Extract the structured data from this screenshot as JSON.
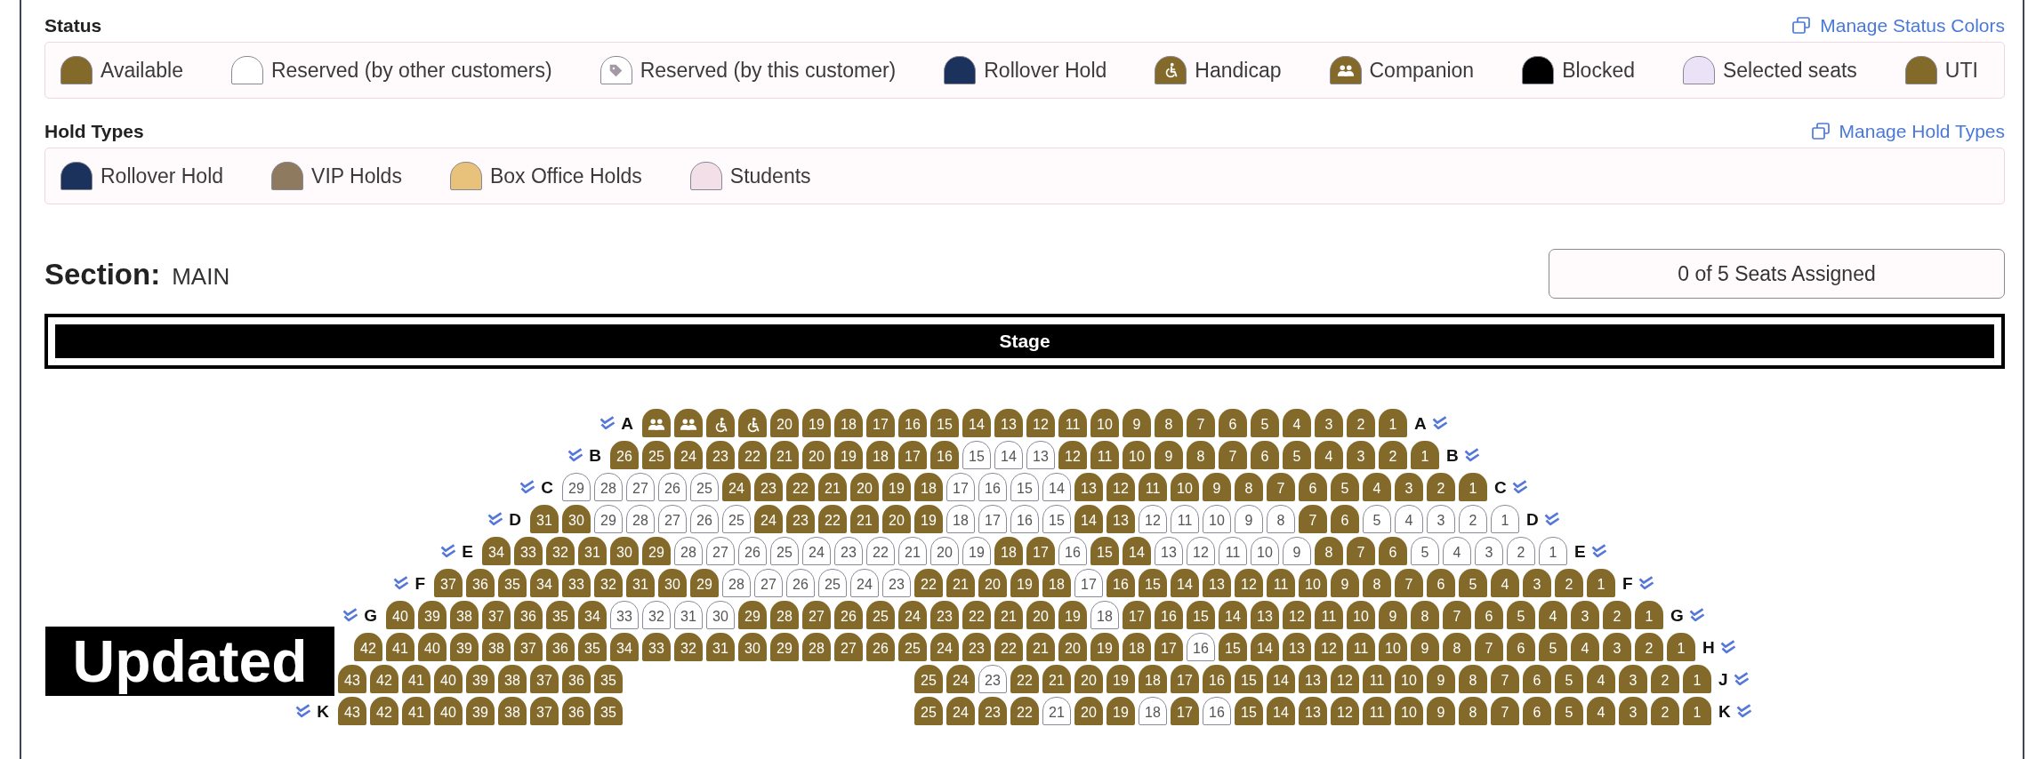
{
  "status": {
    "title": "Status",
    "link": "Manage Status Colors",
    "items": [
      {
        "label": "Available",
        "color": "#836a2b",
        "kind": "plain"
      },
      {
        "label": "Reserved (by other customers)",
        "color": "#ffffff",
        "kind": "plain"
      },
      {
        "label": "Reserved (by this customer)",
        "color": "#ffffff",
        "kind": "tag"
      },
      {
        "label": "Rollover Hold",
        "color": "#1b335c",
        "kind": "plain"
      },
      {
        "label": "Handicap",
        "color": "#836a2b",
        "kind": "wheelchair"
      },
      {
        "label": "Companion",
        "color": "#836a2b",
        "kind": "companion"
      },
      {
        "label": "Blocked",
        "color": "#000000",
        "kind": "plain"
      },
      {
        "label": "Selected seats",
        "color": "#ece2f8",
        "kind": "plain"
      },
      {
        "label": "UTI",
        "color": "#836a2b",
        "kind": "plain"
      }
    ]
  },
  "hold_types": {
    "title": "Hold Types",
    "link": "Manage Hold Types",
    "items": [
      {
        "label": "Rollover Hold",
        "color": "#1b335c"
      },
      {
        "label": "VIP Holds",
        "color": "#8e7a5f"
      },
      {
        "label": "Box Office Holds",
        "color": "#e8c27a"
      },
      {
        "label": "Students",
        "color": "#f3dfe8"
      }
    ]
  },
  "section": {
    "label": "Section:",
    "name": "MAIN",
    "assigned": "0 of 5 Seats Assigned"
  },
  "stage": {
    "label": "Stage"
  },
  "rows": [
    {
      "label_left": "A",
      "label_right": "A",
      "seats": [
        {
          "kind": "companion"
        },
        {
          "kind": "companion"
        },
        {
          "kind": "handicap"
        },
        {
          "kind": "handicap"
        },
        {
          "number": "20",
          "kind": "available"
        },
        {
          "number": "19",
          "kind": "available"
        },
        {
          "number": "18",
          "kind": "available"
        },
        {
          "number": "17",
          "kind": "available"
        },
        {
          "number": "16",
          "kind": "available"
        },
        {
          "number": "15",
          "kind": "available"
        },
        {
          "number": "14",
          "kind": "available"
        },
        {
          "number": "13",
          "kind": "available"
        },
        {
          "number": "12",
          "kind": "available"
        },
        {
          "number": "11",
          "kind": "available"
        },
        {
          "number": "10",
          "kind": "available"
        },
        {
          "number": "9",
          "kind": "available"
        },
        {
          "number": "8",
          "kind": "available"
        },
        {
          "number": "7",
          "kind": "available"
        },
        {
          "number": "6",
          "kind": "available"
        },
        {
          "number": "5",
          "kind": "available"
        },
        {
          "number": "4",
          "kind": "available"
        },
        {
          "number": "3",
          "kind": "available"
        },
        {
          "number": "2",
          "kind": "available"
        },
        {
          "number": "1",
          "kind": "available"
        }
      ]
    },
    {
      "label_left": "B",
      "label_right": "B",
      "seats": [
        {
          "number": "26",
          "kind": "available"
        },
        {
          "number": "25",
          "kind": "available"
        },
        {
          "number": "24",
          "kind": "available"
        },
        {
          "number": "23",
          "kind": "available"
        },
        {
          "number": "22",
          "kind": "available"
        },
        {
          "number": "21",
          "kind": "available"
        },
        {
          "number": "20",
          "kind": "available"
        },
        {
          "number": "19",
          "kind": "available"
        },
        {
          "number": "18",
          "kind": "available"
        },
        {
          "number": "17",
          "kind": "available"
        },
        {
          "number": "16",
          "kind": "available"
        },
        {
          "number": "15",
          "kind": "reserved"
        },
        {
          "number": "14",
          "kind": "reserved"
        },
        {
          "number": "13",
          "kind": "reserved"
        },
        {
          "number": "12",
          "kind": "available"
        },
        {
          "number": "11",
          "kind": "available"
        },
        {
          "number": "10",
          "kind": "available"
        },
        {
          "number": "9",
          "kind": "available"
        },
        {
          "number": "8",
          "kind": "available"
        },
        {
          "number": "7",
          "kind": "available"
        },
        {
          "number": "6",
          "kind": "available"
        },
        {
          "number": "5",
          "kind": "available"
        },
        {
          "number": "4",
          "kind": "available"
        },
        {
          "number": "3",
          "kind": "available"
        },
        {
          "number": "2",
          "kind": "available"
        },
        {
          "number": "1",
          "kind": "available"
        }
      ]
    },
    {
      "label_left": "C",
      "label_right": "C",
      "seats": [
        {
          "number": "29",
          "kind": "reserved"
        },
        {
          "number": "28",
          "kind": "reserved"
        },
        {
          "number": "27",
          "kind": "reserved"
        },
        {
          "number": "26",
          "kind": "reserved"
        },
        {
          "number": "25",
          "kind": "reserved"
        },
        {
          "number": "24",
          "kind": "available"
        },
        {
          "number": "23",
          "kind": "available"
        },
        {
          "number": "22",
          "kind": "available"
        },
        {
          "number": "21",
          "kind": "available"
        },
        {
          "number": "20",
          "kind": "available"
        },
        {
          "number": "19",
          "kind": "available"
        },
        {
          "number": "18",
          "kind": "available"
        },
        {
          "number": "17",
          "kind": "reserved"
        },
        {
          "number": "16",
          "kind": "reserved"
        },
        {
          "number": "15",
          "kind": "reserved"
        },
        {
          "number": "14",
          "kind": "reserved"
        },
        {
          "number": "13",
          "kind": "available"
        },
        {
          "number": "12",
          "kind": "available"
        },
        {
          "number": "11",
          "kind": "available"
        },
        {
          "number": "10",
          "kind": "available"
        },
        {
          "number": "9",
          "kind": "available"
        },
        {
          "number": "8",
          "kind": "available"
        },
        {
          "number": "7",
          "kind": "available"
        },
        {
          "number": "6",
          "kind": "available"
        },
        {
          "number": "5",
          "kind": "available"
        },
        {
          "number": "4",
          "kind": "available"
        },
        {
          "number": "3",
          "kind": "available"
        },
        {
          "number": "2",
          "kind": "available"
        },
        {
          "number": "1",
          "kind": "available"
        }
      ]
    },
    {
      "label_left": "D",
      "label_right": "D",
      "seats": [
        {
          "number": "31",
          "kind": "available"
        },
        {
          "number": "30",
          "kind": "available"
        },
        {
          "number": "29",
          "kind": "reserved"
        },
        {
          "number": "28",
          "kind": "reserved"
        },
        {
          "number": "27",
          "kind": "reserved"
        },
        {
          "number": "26",
          "kind": "reserved"
        },
        {
          "number": "25",
          "kind": "reserved"
        },
        {
          "number": "24",
          "kind": "available"
        },
        {
          "number": "23",
          "kind": "available"
        },
        {
          "number": "22",
          "kind": "available"
        },
        {
          "number": "21",
          "kind": "available"
        },
        {
          "number": "20",
          "kind": "available"
        },
        {
          "number": "19",
          "kind": "available"
        },
        {
          "number": "18",
          "kind": "reserved"
        },
        {
          "number": "17",
          "kind": "reserved"
        },
        {
          "number": "16",
          "kind": "reserved"
        },
        {
          "number": "15",
          "kind": "reserved"
        },
        {
          "number": "14",
          "kind": "available"
        },
        {
          "number": "13",
          "kind": "available"
        },
        {
          "number": "12",
          "kind": "reserved"
        },
        {
          "number": "11",
          "kind": "reserved"
        },
        {
          "number": "10",
          "kind": "reserved"
        },
        {
          "number": "9",
          "kind": "reserved"
        },
        {
          "number": "8",
          "kind": "reserved"
        },
        {
          "number": "7",
          "kind": "available"
        },
        {
          "number": "6",
          "kind": "available"
        },
        {
          "number": "5",
          "kind": "reserved"
        },
        {
          "number": "4",
          "kind": "reserved"
        },
        {
          "number": "3",
          "kind": "reserved"
        },
        {
          "number": "2",
          "kind": "reserved"
        },
        {
          "number": "1",
          "kind": "reserved"
        }
      ]
    },
    {
      "label_left": "E",
      "label_right": "E",
      "seats": [
        {
          "number": "34",
          "kind": "available"
        },
        {
          "number": "33",
          "kind": "available"
        },
        {
          "number": "32",
          "kind": "available"
        },
        {
          "number": "31",
          "kind": "available"
        },
        {
          "number": "30",
          "kind": "available"
        },
        {
          "number": "29",
          "kind": "available"
        },
        {
          "number": "28",
          "kind": "reserved"
        },
        {
          "number": "27",
          "kind": "reserved"
        },
        {
          "number": "26",
          "kind": "reserved"
        },
        {
          "number": "25",
          "kind": "reserved"
        },
        {
          "number": "24",
          "kind": "reserved"
        },
        {
          "number": "23",
          "kind": "reserved"
        },
        {
          "number": "22",
          "kind": "reserved"
        },
        {
          "number": "21",
          "kind": "reserved"
        },
        {
          "number": "20",
          "kind": "reserved"
        },
        {
          "number": "19",
          "kind": "reserved"
        },
        {
          "number": "18",
          "kind": "available"
        },
        {
          "number": "17",
          "kind": "available"
        },
        {
          "number": "16",
          "kind": "reserved"
        },
        {
          "number": "15",
          "kind": "available"
        },
        {
          "number": "14",
          "kind": "available"
        },
        {
          "number": "13",
          "kind": "reserved"
        },
        {
          "number": "12",
          "kind": "reserved"
        },
        {
          "number": "11",
          "kind": "reserved"
        },
        {
          "number": "10",
          "kind": "reserved"
        },
        {
          "number": "9",
          "kind": "reserved"
        },
        {
          "number": "8",
          "kind": "available"
        },
        {
          "number": "7",
          "kind": "available"
        },
        {
          "number": "6",
          "kind": "available"
        },
        {
          "number": "5",
          "kind": "reserved"
        },
        {
          "number": "4",
          "kind": "reserved"
        },
        {
          "number": "3",
          "kind": "reserved"
        },
        {
          "number": "2",
          "kind": "reserved"
        },
        {
          "number": "1",
          "kind": "reserved"
        }
      ]
    },
    {
      "label_left": "F",
      "label_right": "F",
      "seats": [
        {
          "number": "37",
          "kind": "available"
        },
        {
          "number": "36",
          "kind": "available"
        },
        {
          "number": "35",
          "kind": "available"
        },
        {
          "number": "34",
          "kind": "available"
        },
        {
          "number": "33",
          "kind": "available"
        },
        {
          "number": "32",
          "kind": "available"
        },
        {
          "number": "31",
          "kind": "available"
        },
        {
          "number": "30",
          "kind": "available"
        },
        {
          "number": "29",
          "kind": "available"
        },
        {
          "number": "28",
          "kind": "reserved"
        },
        {
          "number": "27",
          "kind": "reserved"
        },
        {
          "number": "26",
          "kind": "reserved"
        },
        {
          "number": "25",
          "kind": "reserved"
        },
        {
          "number": "24",
          "kind": "reserved"
        },
        {
          "number": "23",
          "kind": "reserved"
        },
        {
          "number": "22",
          "kind": "available"
        },
        {
          "number": "21",
          "kind": "available"
        },
        {
          "number": "20",
          "kind": "available"
        },
        {
          "number": "19",
          "kind": "available"
        },
        {
          "number": "18",
          "kind": "available"
        },
        {
          "number": "17",
          "kind": "reserved"
        },
        {
          "number": "16",
          "kind": "available"
        },
        {
          "number": "15",
          "kind": "available"
        },
        {
          "number": "14",
          "kind": "available"
        },
        {
          "number": "13",
          "kind": "available"
        },
        {
          "number": "12",
          "kind": "available"
        },
        {
          "number": "11",
          "kind": "available"
        },
        {
          "number": "10",
          "kind": "available"
        },
        {
          "number": "9",
          "kind": "available"
        },
        {
          "number": "8",
          "kind": "available"
        },
        {
          "number": "7",
          "kind": "available"
        },
        {
          "number": "6",
          "kind": "available"
        },
        {
          "number": "5",
          "kind": "available"
        },
        {
          "number": "4",
          "kind": "available"
        },
        {
          "number": "3",
          "kind": "available"
        },
        {
          "number": "2",
          "kind": "available"
        },
        {
          "number": "1",
          "kind": "available"
        }
      ]
    },
    {
      "label_left": "G",
      "label_right": "G",
      "seats": [
        {
          "number": "40",
          "kind": "available"
        },
        {
          "number": "39",
          "kind": "available"
        },
        {
          "number": "38",
          "kind": "available"
        },
        {
          "number": "37",
          "kind": "available"
        },
        {
          "number": "36",
          "kind": "available"
        },
        {
          "number": "35",
          "kind": "available"
        },
        {
          "number": "34",
          "kind": "available"
        },
        {
          "number": "33",
          "kind": "reserved"
        },
        {
          "number": "32",
          "kind": "reserved"
        },
        {
          "number": "31",
          "kind": "reserved"
        },
        {
          "number": "30",
          "kind": "reserved"
        },
        {
          "number": "29",
          "kind": "available"
        },
        {
          "number": "28",
          "kind": "available"
        },
        {
          "number": "27",
          "kind": "available"
        },
        {
          "number": "26",
          "kind": "available"
        },
        {
          "number": "25",
          "kind": "available"
        },
        {
          "number": "24",
          "kind": "available"
        },
        {
          "number": "23",
          "kind": "available"
        },
        {
          "number": "22",
          "kind": "available"
        },
        {
          "number": "21",
          "kind": "available"
        },
        {
          "number": "20",
          "kind": "available"
        },
        {
          "number": "19",
          "kind": "available"
        },
        {
          "number": "18",
          "kind": "reserved"
        },
        {
          "number": "17",
          "kind": "available"
        },
        {
          "number": "16",
          "kind": "available"
        },
        {
          "number": "15",
          "kind": "available"
        },
        {
          "number": "14",
          "kind": "available"
        },
        {
          "number": "13",
          "kind": "available"
        },
        {
          "number": "12",
          "kind": "available"
        },
        {
          "number": "11",
          "kind": "available"
        },
        {
          "number": "10",
          "kind": "available"
        },
        {
          "number": "9",
          "kind": "available"
        },
        {
          "number": "8",
          "kind": "available"
        },
        {
          "number": "7",
          "kind": "available"
        },
        {
          "number": "6",
          "kind": "available"
        },
        {
          "number": "5",
          "kind": "available"
        },
        {
          "number": "4",
          "kind": "available"
        },
        {
          "number": "3",
          "kind": "available"
        },
        {
          "number": "2",
          "kind": "available"
        },
        {
          "number": "1",
          "kind": "available"
        }
      ]
    },
    {
      "label_right": "H",
      "seats": [
        {
          "number": "42",
          "kind": "available"
        },
        {
          "number": "41",
          "kind": "available"
        },
        {
          "number": "40",
          "kind": "available"
        },
        {
          "number": "39",
          "kind": "available"
        },
        {
          "number": "38",
          "kind": "available"
        },
        {
          "number": "37",
          "kind": "available"
        },
        {
          "number": "36",
          "kind": "available"
        },
        {
          "number": "35",
          "kind": "available"
        },
        {
          "number": "34",
          "kind": "available"
        },
        {
          "number": "33",
          "kind": "available"
        },
        {
          "number": "32",
          "kind": "available"
        },
        {
          "number": "31",
          "kind": "available"
        },
        {
          "number": "30",
          "kind": "available"
        },
        {
          "number": "29",
          "kind": "available"
        },
        {
          "number": "28",
          "kind": "available"
        },
        {
          "number": "27",
          "kind": "available"
        },
        {
          "number": "26",
          "kind": "available"
        },
        {
          "number": "25",
          "kind": "available"
        },
        {
          "number": "24",
          "kind": "available"
        },
        {
          "number": "23",
          "kind": "available"
        },
        {
          "number": "22",
          "kind": "available"
        },
        {
          "number": "21",
          "kind": "available"
        },
        {
          "number": "20",
          "kind": "available"
        },
        {
          "number": "19",
          "kind": "available"
        },
        {
          "number": "18",
          "kind": "available"
        },
        {
          "number": "17",
          "kind": "available"
        },
        {
          "number": "16",
          "kind": "reserved"
        },
        {
          "number": "15",
          "kind": "available"
        },
        {
          "number": "14",
          "kind": "available"
        },
        {
          "number": "13",
          "kind": "available"
        },
        {
          "number": "12",
          "kind": "available"
        },
        {
          "number": "11",
          "kind": "available"
        },
        {
          "number": "10",
          "kind": "available"
        },
        {
          "number": "9",
          "kind": "available"
        },
        {
          "number": "8",
          "kind": "available"
        },
        {
          "number": "7",
          "kind": "available"
        },
        {
          "number": "6",
          "kind": "available"
        },
        {
          "number": "5",
          "kind": "available"
        },
        {
          "number": "4",
          "kind": "available"
        },
        {
          "number": "3",
          "kind": "available"
        },
        {
          "number": "2",
          "kind": "available"
        },
        {
          "number": "1",
          "kind": "available"
        }
      ]
    },
    {
      "label_right": "J",
      "seats": [
        {
          "number": "43",
          "kind": "available"
        },
        {
          "number": "42",
          "kind": "available"
        },
        {
          "number": "41",
          "kind": "available"
        },
        {
          "number": "40",
          "kind": "available"
        },
        {
          "number": "39",
          "kind": "available"
        },
        {
          "number": "38",
          "kind": "available"
        },
        {
          "number": "37",
          "kind": "available"
        },
        {
          "number": "36",
          "kind": "available"
        },
        {
          "number": "35",
          "kind": "available"
        },
        {
          "number": "25",
          "kind": "available"
        },
        {
          "number": "24",
          "kind": "available"
        },
        {
          "number": "23",
          "kind": "reserved"
        },
        {
          "number": "22",
          "kind": "available"
        },
        {
          "number": "21",
          "kind": "available"
        },
        {
          "number": "20",
          "kind": "available"
        },
        {
          "number": "19",
          "kind": "available"
        },
        {
          "number": "18",
          "kind": "available"
        },
        {
          "number": "17",
          "kind": "available"
        },
        {
          "number": "16",
          "kind": "available"
        },
        {
          "number": "15",
          "kind": "available"
        },
        {
          "number": "14",
          "kind": "available"
        },
        {
          "number": "13",
          "kind": "available"
        },
        {
          "number": "12",
          "kind": "available"
        },
        {
          "number": "11",
          "kind": "available"
        },
        {
          "number": "10",
          "kind": "available"
        },
        {
          "number": "9",
          "kind": "available"
        },
        {
          "number": "8",
          "kind": "available"
        },
        {
          "number": "7",
          "kind": "available"
        },
        {
          "number": "6",
          "kind": "available"
        },
        {
          "number": "5",
          "kind": "available"
        },
        {
          "number": "4",
          "kind": "available"
        },
        {
          "number": "3",
          "kind": "available"
        },
        {
          "number": "2",
          "kind": "available"
        },
        {
          "number": "1",
          "kind": "available"
        }
      ]
    },
    {
      "label_left": "K",
      "label_right": "K",
      "seats": [
        {
          "number": "43",
          "kind": "available"
        },
        {
          "number": "42",
          "kind": "available"
        },
        {
          "number": "41",
          "kind": "available"
        },
        {
          "number": "40",
          "kind": "available"
        },
        {
          "number": "39",
          "kind": "available"
        },
        {
          "number": "38",
          "kind": "available"
        },
        {
          "number": "37",
          "kind": "available"
        },
        {
          "number": "36",
          "kind": "available"
        },
        {
          "number": "35",
          "kind": "available"
        },
        {
          "number": "25",
          "kind": "available"
        },
        {
          "number": "24",
          "kind": "available"
        },
        {
          "number": "23",
          "kind": "available"
        },
        {
          "number": "22",
          "kind": "available"
        },
        {
          "number": "21",
          "kind": "reserved"
        },
        {
          "number": "20",
          "kind": "available"
        },
        {
          "number": "19",
          "kind": "available"
        },
        {
          "number": "18",
          "kind": "reserved"
        },
        {
          "number": "17",
          "kind": "available"
        },
        {
          "number": "16",
          "kind": "reserved"
        },
        {
          "number": "15",
          "kind": "available"
        },
        {
          "number": "14",
          "kind": "available"
        },
        {
          "number": "13",
          "kind": "available"
        },
        {
          "number": "12",
          "kind": "available"
        },
        {
          "number": "11",
          "kind": "available"
        },
        {
          "number": "10",
          "kind": "available"
        },
        {
          "number": "9",
          "kind": "available"
        },
        {
          "number": "8",
          "kind": "available"
        },
        {
          "number": "7",
          "kind": "available"
        },
        {
          "number": "6",
          "kind": "available"
        },
        {
          "number": "5",
          "kind": "available"
        },
        {
          "number": "4",
          "kind": "available"
        },
        {
          "number": "3",
          "kind": "available"
        },
        {
          "number": "2",
          "kind": "available"
        },
        {
          "number": "1",
          "kind": "available"
        }
      ]
    }
  ],
  "overlay_label": "Updated"
}
